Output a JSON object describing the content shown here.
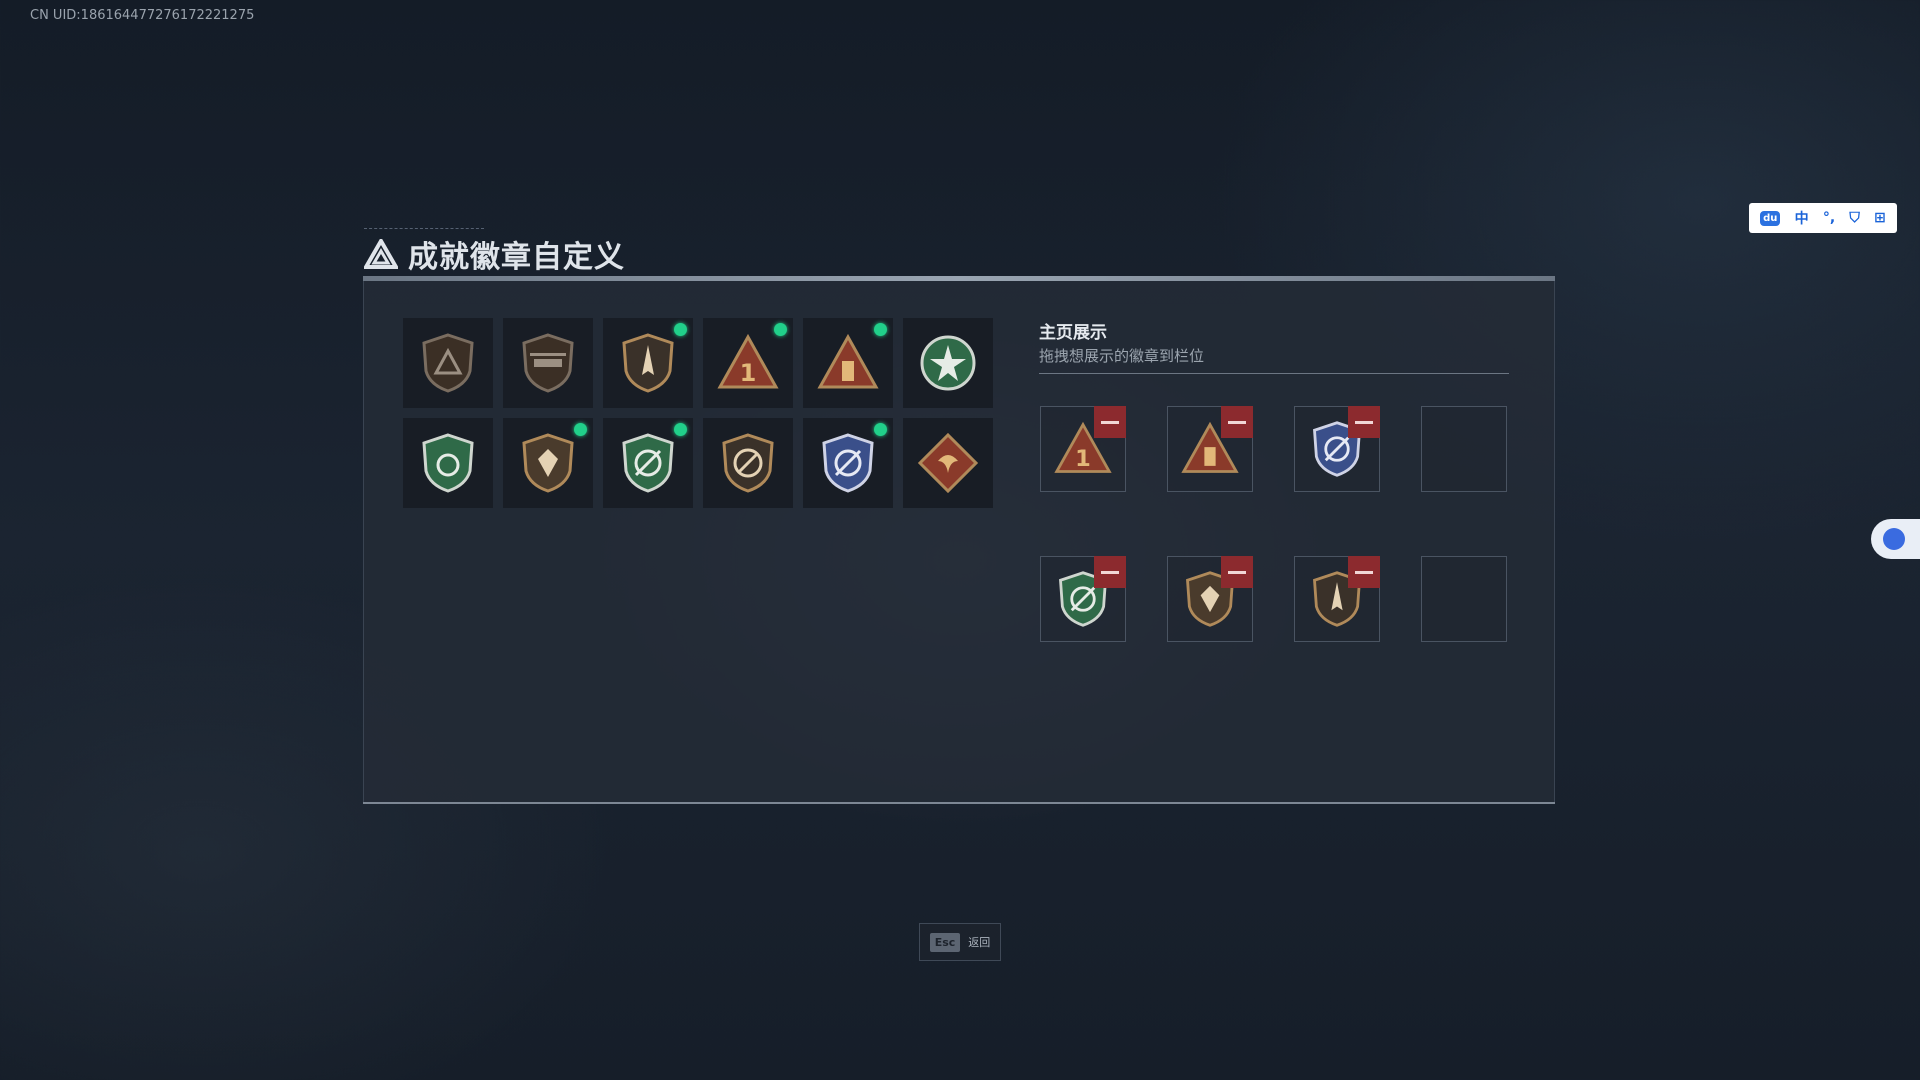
{
  "uid_text": "CN UID:1861644772761722212​75",
  "page_title": "成就徽章自定义",
  "display": {
    "title": "主页展示",
    "subtitle": "拖拽想展示的徽章到栏位"
  },
  "badges": [
    {
      "icon": "triangle-shield-badge-icon",
      "new": false
    },
    {
      "icon": "helicopter-shield-badge-icon",
      "new": false
    },
    {
      "icon": "arrow-shield-badge-icon",
      "new": true
    },
    {
      "icon": "number-one-triangle-badge-icon",
      "new": true
    },
    {
      "icon": "tower-triangle-badge-icon",
      "new": true
    },
    {
      "icon": "star-green-badge-icon",
      "new": false
    },
    {
      "icon": "green-shield-badge-icon",
      "new": false
    },
    {
      "icon": "gem-shield-badge-icon",
      "new": true
    },
    {
      "icon": "green-target-shield-badge-icon",
      "new": true
    },
    {
      "icon": "no-rifle-shield-badge-icon",
      "new": false
    },
    {
      "icon": "blue-target-shield-badge-icon",
      "new": true
    },
    {
      "icon": "dragon-diamond-badge-icon",
      "new": false
    }
  ],
  "slots": [
    {
      "icon": "number-one-triangle-badge-icon",
      "filled": true
    },
    {
      "icon": "tower-triangle-badge-icon",
      "filled": true
    },
    {
      "icon": "blue-target-shield-badge-icon",
      "filled": true
    },
    {
      "icon": "",
      "filled": false
    },
    {
      "icon": "green-target-shield-badge-icon",
      "filled": true
    },
    {
      "icon": "gem-shield-badge-icon",
      "filled": true
    },
    {
      "icon": "arrow-shield-badge-icon",
      "filled": true
    },
    {
      "icon": "",
      "filled": false
    }
  ],
  "esc": {
    "key": "Esc",
    "label": "返回"
  },
  "ime": {
    "lang": "中",
    "logo": "du"
  },
  "colors": {
    "new_dot": "#21d08a",
    "remove": "#8c2a2e",
    "bronze": "#b08a5a"
  }
}
